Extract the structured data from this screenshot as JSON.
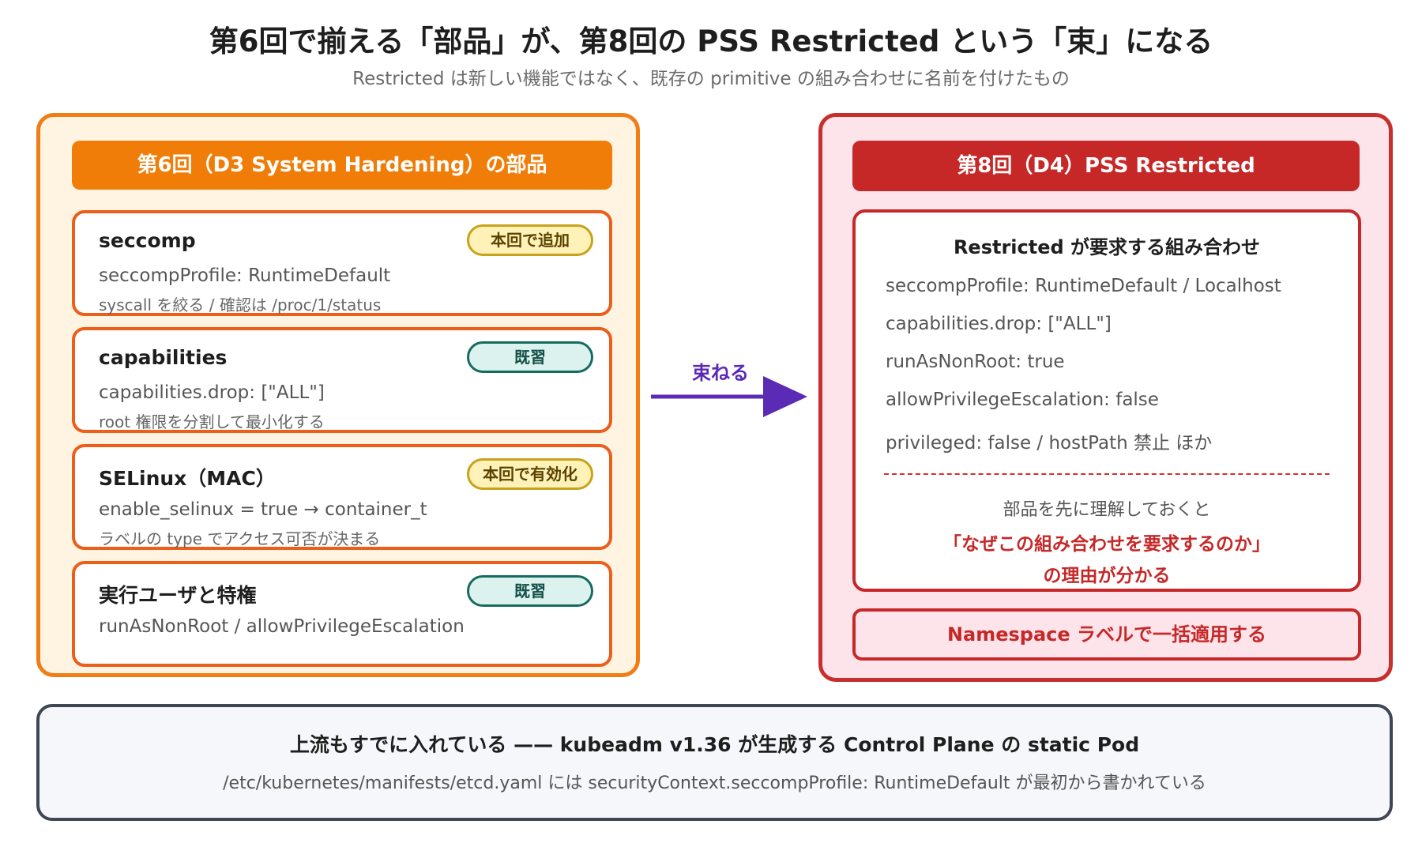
{
  "title": "第6回で揃える「部品」が、第8回の PSS Restricted という「束」になる",
  "subtitle": "Restricted は新しい機能ではなく、既存の primitive の組み合わせに名前を付けたもの",
  "left_panel": {
    "header": "第6回（D3 System Hardening）の部品",
    "parts": [
      {
        "title": "seccomp",
        "badge": "本回で追加",
        "line1": "seccompProfile: RuntimeDefault",
        "line2": "syscall を絞る / 確認は /proc/1/status"
      },
      {
        "title": "capabilities",
        "badge": "既習",
        "line1": "capabilities.drop: [\"ALL\"]",
        "line2": "root 権限を分割して最小化する"
      },
      {
        "title": "SELinux（MAC）",
        "badge": "本回で有効化",
        "line1": "enable_selinux = true → container_t",
        "line2": "ラベルの type でアクセス可否が決まる"
      },
      {
        "title": "実行ユーザと特権",
        "badge": "既習",
        "line1": "runAsNonRoot / allowPrivilegeEscalation",
        "line2": ""
      }
    ]
  },
  "arrow": {
    "label": "束ねる"
  },
  "right_panel": {
    "header": "第8回（D4）PSS Restricted",
    "requirements": {
      "title": "Restricted が要求する組み合わせ",
      "items": [
        "seccompProfile: RuntimeDefault / Localhost",
        "capabilities.drop: [\"ALL\"]",
        "runAsNonRoot: true",
        "allowPrivilegeEscalation: false",
        "privileged: false / hostPath 禁止 ほか"
      ],
      "note": "部品を先に理解しておくと",
      "emphasis_1": "「なぜこの組み合わせを要求するのか」",
      "emphasis_2": "の理由が分かる"
    },
    "namespace": "Namespace ラベルで一括適用する"
  },
  "bottom": {
    "title": "上流もすでに入れている —— kubeadm v1.36 が生成する Control Plane の static Pod",
    "text": "/etc/kubernetes/manifests/etcd.yaml には securityContext.seccompProfile: RuntimeDefault が最初から書かれている"
  },
  "colors": {
    "left_accent": "#f07d07",
    "left_background": "#fff3e2",
    "right_accent": "#c62828",
    "right_background": "#fde4ea",
    "arrow": "#5b2bb5",
    "badge_new": "#fff2b8",
    "badge_review": "#dcf2ee"
  }
}
